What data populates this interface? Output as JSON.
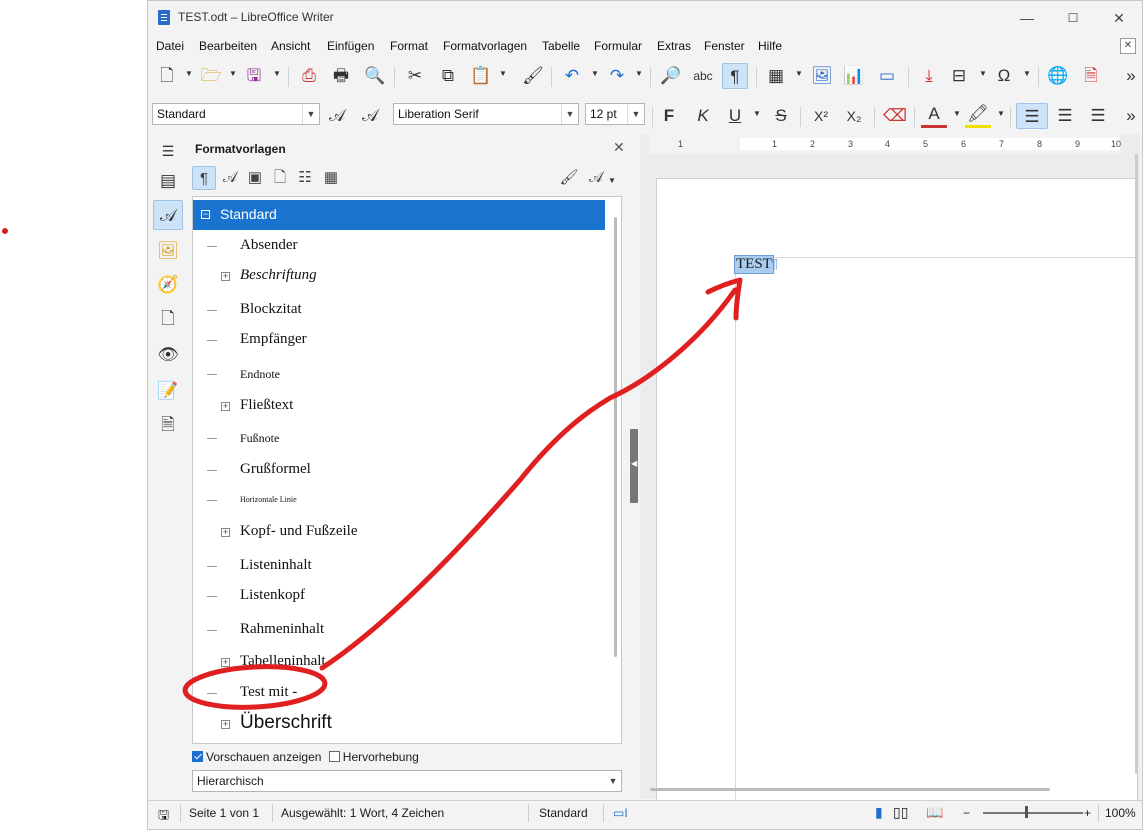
{
  "window": {
    "title": "TEST.odt – LibreOffice Writer",
    "controls": {
      "minimize": "—",
      "maximize": "☐",
      "close": "✕"
    }
  },
  "menu": [
    {
      "label": "Datei"
    },
    {
      "label": "Bearbeiten"
    },
    {
      "label": "Ansicht"
    },
    {
      "label": "Einfügen"
    },
    {
      "label": "Format"
    },
    {
      "label": "Formatvorlagen"
    },
    {
      "label": "Tabelle"
    },
    {
      "label": "Formular"
    },
    {
      "label": "Extras"
    },
    {
      "label": "Fenster"
    },
    {
      "label": "Hilfe"
    }
  ],
  "toolbar": {
    "paragraph_style": "Standard",
    "font_name": "Liberation Serif",
    "font_size": "12 pt",
    "bold": "F",
    "italic": "K",
    "underline": "U",
    "strike": "S",
    "superscript": "X²",
    "subscript": "X₂",
    "font_color": "A",
    "more": "»"
  },
  "sidebar": {
    "title": "Formatvorlagen",
    "close": "✕",
    "styles": [
      {
        "label": "Standard",
        "selected": true,
        "expandable": true,
        "expander": "−"
      },
      {
        "label": "Absender"
      },
      {
        "label": "Beschriftung",
        "expandable": true,
        "expander": "+",
        "italic": true
      },
      {
        "label": "Blockzitat"
      },
      {
        "label": "Empfänger"
      },
      {
        "label": "Endnote",
        "small": true
      },
      {
        "label": "Fließtext",
        "expandable": true,
        "expander": "+"
      },
      {
        "label": "Fußnote",
        "small": true
      },
      {
        "label": "Grußformel"
      },
      {
        "label": "Horizontale Linie",
        "tiny": true
      },
      {
        "label": "Kopf- und Fußzeile",
        "expandable": true,
        "expander": "+"
      },
      {
        "label": "Listeninhalt"
      },
      {
        "label": "Listenkopf"
      },
      {
        "label": "Rahmeninhalt"
      },
      {
        "label": "Tabelleninhalt",
        "expandable": true,
        "expander": "+"
      },
      {
        "label": "Test mit -"
      },
      {
        "label": "Überschrift",
        "expandable": true,
        "expander": "+",
        "large": true
      }
    ],
    "show_previews_label": "Vorschauen anzeigen",
    "show_previews_checked": true,
    "highlight_label": "Hervorhebung",
    "highlight_checked": false,
    "filter": "Hierarchisch"
  },
  "ruler": {
    "numbers": [
      "1",
      "1",
      "2",
      "3",
      "4",
      "5",
      "6",
      "7",
      "8",
      "9",
      "10"
    ]
  },
  "document": {
    "text": "TEST",
    "pilcrow": "¶"
  },
  "status": {
    "page": "Seite 1 von 1",
    "selection": "Ausgewählt: 1 Wort, 4 Zeichen",
    "page_style": "Standard",
    "zoom": "100%",
    "zoom_minus": "−",
    "zoom_plus": "+"
  },
  "colors": {
    "accent": "#1a73cf",
    "annotation": "#e02020",
    "selection": "#a8cdf0"
  }
}
